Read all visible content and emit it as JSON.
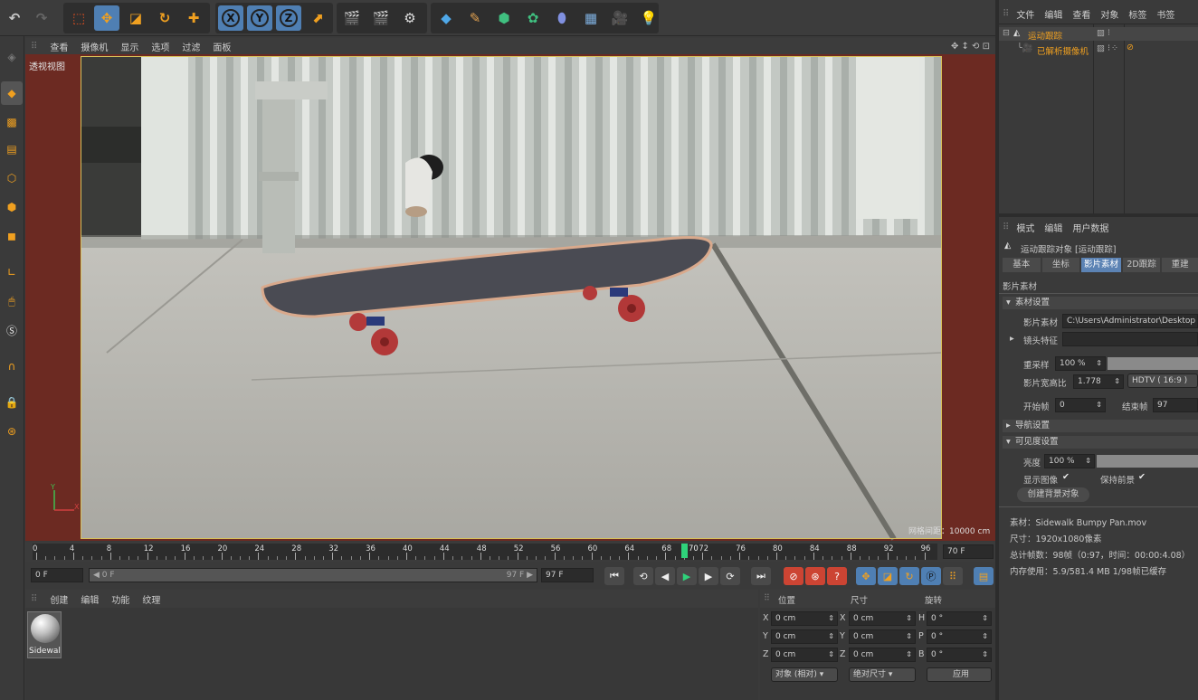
{
  "toolbar": {
    "icons": [
      "undo-icon",
      "redo-icon",
      "live-select-icon",
      "move-icon",
      "scale-icon",
      "rotate-icon",
      "add-icon",
      "x-axis-icon",
      "y-axis-icon",
      "z-axis-icon",
      "coordinate-system-icon",
      "render-view-icon",
      "render-picture-viewer-icon",
      "render-settings-icon",
      "cube-icon",
      "pen-icon",
      "subdivision-icon",
      "cloner-icon",
      "deformer-icon",
      "floor-icon",
      "camera-icon",
      "light-icon"
    ],
    "x_label": "X",
    "y_label": "Y",
    "z_label": "Z"
  },
  "viewport": {
    "menu": [
      "查看",
      "摄像机",
      "显示",
      "选项",
      "过滤",
      "面板"
    ],
    "label": "透视视图",
    "grid_info": "网格间距：10000 cm",
    "axis_y": "Y",
    "axis_x": "X"
  },
  "timeline": {
    "ticks": [
      "0",
      "4",
      "8",
      "12",
      "16",
      "20",
      "24",
      "28",
      "32",
      "36",
      "40",
      "44",
      "48",
      "52",
      "56",
      "60",
      "64",
      "68",
      "72",
      "76",
      "80",
      "84",
      "88",
      "92",
      "96"
    ],
    "current": "70",
    "end_field": "70 F"
  },
  "transport": {
    "start_field": "0 F",
    "range_start": "◀ 0 F",
    "range_end": "97 F ▶",
    "end_field": "97 F"
  },
  "material_manager": {
    "menu": [
      "创建",
      "编辑",
      "功能",
      "纹理"
    ],
    "material_name": "Sidewal"
  },
  "coordinates": {
    "headers": [
      "位置",
      "尺寸",
      "旋转"
    ],
    "rows": [
      {
        "axis": "X",
        "pos": "0 cm",
        "size_axis": "X",
        "size": "0 cm",
        "rot_axis": "H",
        "rot": "0 °"
      },
      {
        "axis": "Y",
        "pos": "0 cm",
        "size_axis": "Y",
        "size": "0 cm",
        "rot_axis": "P",
        "rot": "0 °"
      },
      {
        "axis": "Z",
        "pos": "0 cm",
        "size_axis": "Z",
        "size": "0 cm",
        "rot_axis": "B",
        "rot": "0 °"
      }
    ],
    "mode_select": "对象 (相对)",
    "size_select": "绝对尺寸",
    "apply": "应用"
  },
  "object_manager": {
    "menu": [
      "文件",
      "编辑",
      "查看",
      "对象",
      "标签",
      "书签"
    ],
    "objects": [
      {
        "name": "运动跟踪"
      },
      {
        "name": "已解析摄像机"
      }
    ]
  },
  "attributes": {
    "menu": [
      "模式",
      "编辑",
      "用户数据"
    ],
    "object_title": "运动跟踪对象 [运动跟踪]",
    "tabs": [
      "基本",
      "坐标",
      "影片素材",
      "2D跟踪",
      "重建"
    ],
    "active_tab": "影片素材",
    "section_title": "影片素材",
    "footage_section": "素材设置",
    "footage_label": "影片素材",
    "footage_path": "C:\\Users\\Administrator\\Desktop",
    "lens_label": "镜头特征",
    "resample_label": "重采样",
    "resample_value": "100 %",
    "resample_level": 1.0,
    "aspect_label": "影片宽高比",
    "aspect_value": "1.778",
    "aspect_preset": "HDTV ( 16:9 )",
    "start_label": "开始帧",
    "start_value": "0",
    "end_label": "结束帧",
    "end_value": "97",
    "nav_section": "导航设置",
    "vis_section": "可见度设置",
    "brightness_label": "亮度",
    "brightness_value": "100 %",
    "brightness_level": 1.0,
    "show_image_label": "显示图像",
    "show_image_check": "✔",
    "keep_fg_label": "保持前景",
    "keep_fg_check": "✔",
    "create_bg_button": "创建背景对象",
    "info_lines": [
      "素材：Sidewalk Bumpy Pan.mov",
      "尺寸：1920x1080像素",
      "总计帧数：98帧（0:97，时间：00:00:4.08）",
      "内存使用：5.9/581.4 MB 1/98帧已缓存"
    ]
  },
  "colors": {
    "accent": "#f0a020",
    "viewport_bg": "#6c2a22",
    "active_tab": "#5c83b4"
  }
}
